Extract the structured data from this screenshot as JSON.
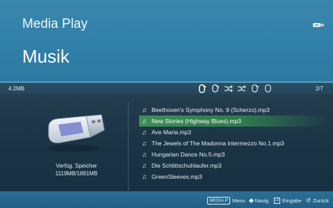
{
  "header": {
    "app_title": "Media Play",
    "section_title": "Musik",
    "device_icon": "usb-drive-icon"
  },
  "infobar": {
    "storage_used": "4.2MB",
    "track_position": "2/7",
    "mode_icons": [
      "repeat-one-icon",
      "repeat-all-icon",
      "shuffle-icon",
      "shuffle-repeat-icon",
      "repeat-folder-icon",
      "repeat-off-icon"
    ]
  },
  "storage": {
    "label": "Verfüg. Speicher",
    "value": "1119MB/1891MB"
  },
  "playlist": {
    "selected_index": 1,
    "tracks": [
      "Beethoven's Symphony No. 9 (Scherzo).mp3",
      "New Stories (Highway Blues).mp3",
      "Ave Maria.mp3",
      "The Jewels of The Madonna Intermezzo No.1.mp3",
      "Hungarian Dance No.5.mp3",
      "Die Schlittschuhlaufer.mp3",
      "GreenSleeves.mp3"
    ]
  },
  "footer": {
    "menu_key": "MEDIA.P",
    "menu_label": "Menu",
    "navig_label": "Navig.",
    "enter_label": "Eingabe",
    "back_label": "Zurück"
  },
  "colors": {
    "header": "#3482ab",
    "content": "#1c3648",
    "selected": "#3a8a55",
    "footer": "#276890"
  }
}
